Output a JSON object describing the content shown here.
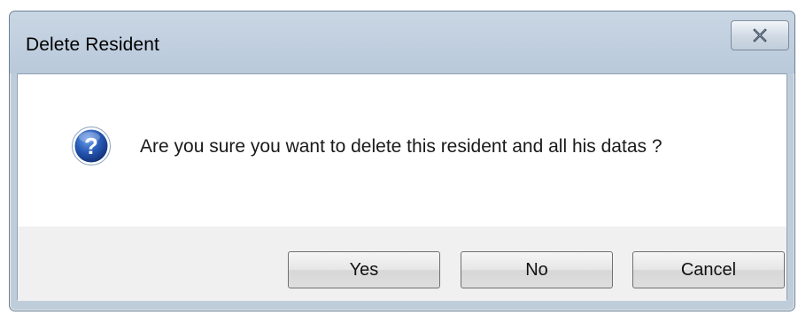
{
  "window": {
    "title": "Delete Resident",
    "close_icon": "close-x-icon"
  },
  "message": {
    "icon": "question-icon",
    "text": "Are you sure you want to delete this resident and all his datas ?"
  },
  "buttons": {
    "yes_label": "Yes",
    "no_label": "No",
    "cancel_label": "Cancel"
  },
  "colors": {
    "frame": "#bfcddb",
    "content_background": "#ffffff",
    "button_row_background": "#f0f0f0",
    "question_icon_blue": "#1f4fa8"
  }
}
